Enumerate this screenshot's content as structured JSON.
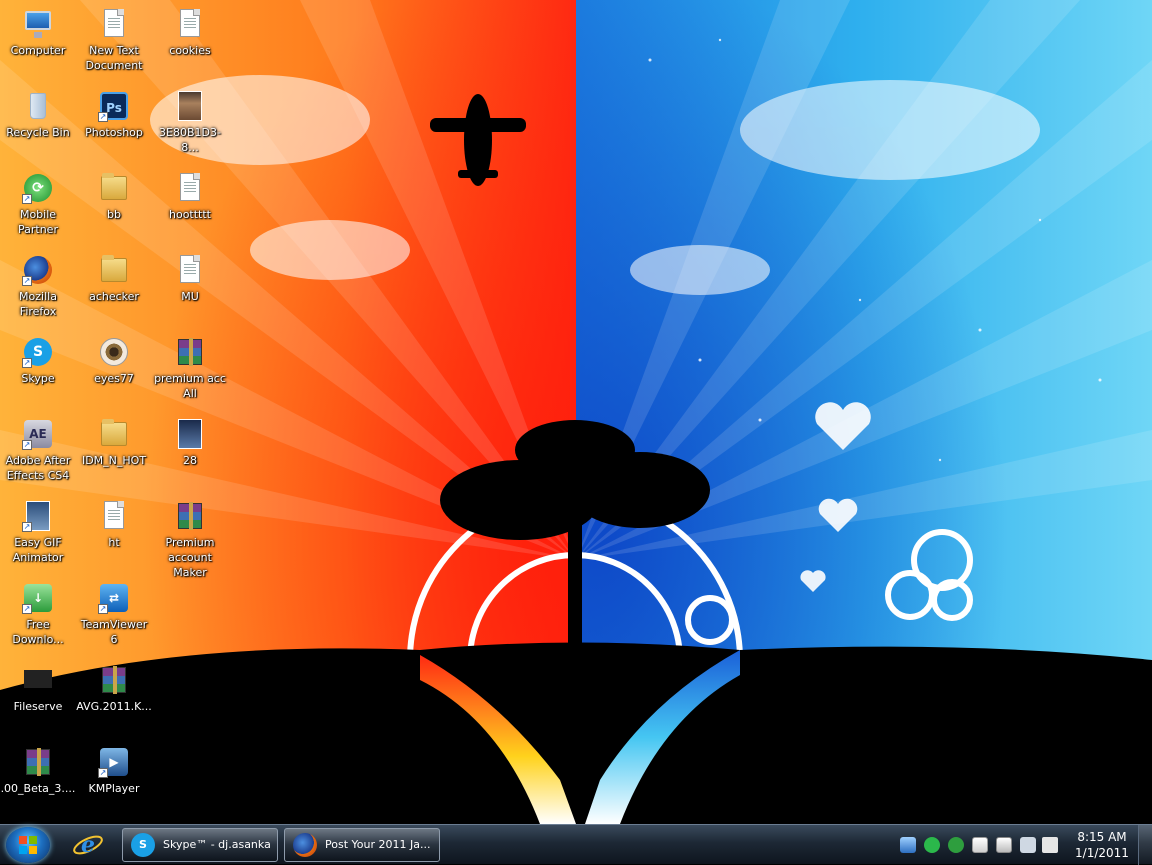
{
  "desktop": {
    "icons": [
      {
        "label": "Computer"
      },
      {
        "label": "New Text Document"
      },
      {
        "label": "cookies"
      },
      {
        "label": "Recycle Bin"
      },
      {
        "label": "Photoshop"
      },
      {
        "label": "3E80B1D3-8..."
      },
      {
        "label": "Mobile Partner"
      },
      {
        "label": "bb"
      },
      {
        "label": "hoottttt"
      },
      {
        "label": "Mozilla Firefox"
      },
      {
        "label": "achecker"
      },
      {
        "label": "MU"
      },
      {
        "label": "Skype"
      },
      {
        "label": "eyes77"
      },
      {
        "label": "premium acc All"
      },
      {
        "label": "Adobe After Effects CS4"
      },
      {
        "label": "IDM_N_HOT"
      },
      {
        "label": "28"
      },
      {
        "label": "Easy GIF Animator"
      },
      {
        "label": "ht"
      },
      {
        "label": "Premium account Maker"
      },
      {
        "label": "Free Downlo..."
      },
      {
        "label": "TeamViewer 6"
      },
      {
        "label": "Fileserve"
      },
      {
        "label": "AVG.2011.K..."
      },
      {
        "label": ".00_Beta_3...."
      },
      {
        "label": "KMPlayer"
      }
    ],
    "icon_glyphs": {
      "photoshop": "Ps",
      "after_effects": "AE",
      "skype": "S"
    }
  },
  "taskbar": {
    "tasks": [
      {
        "label": "Skype™ - dj.asanka",
        "icon": "skype-icon"
      },
      {
        "label": "Post Your 2011 Ja...",
        "icon": "firefox-icon"
      }
    ],
    "clock": {
      "time": "8:15 AM",
      "date": "1/1/2011"
    }
  },
  "colors": {
    "wallpaper_warm": "#ff6a1a",
    "wallpaper_cool": "#1e8fe6",
    "taskbar": "#1d2835"
  }
}
